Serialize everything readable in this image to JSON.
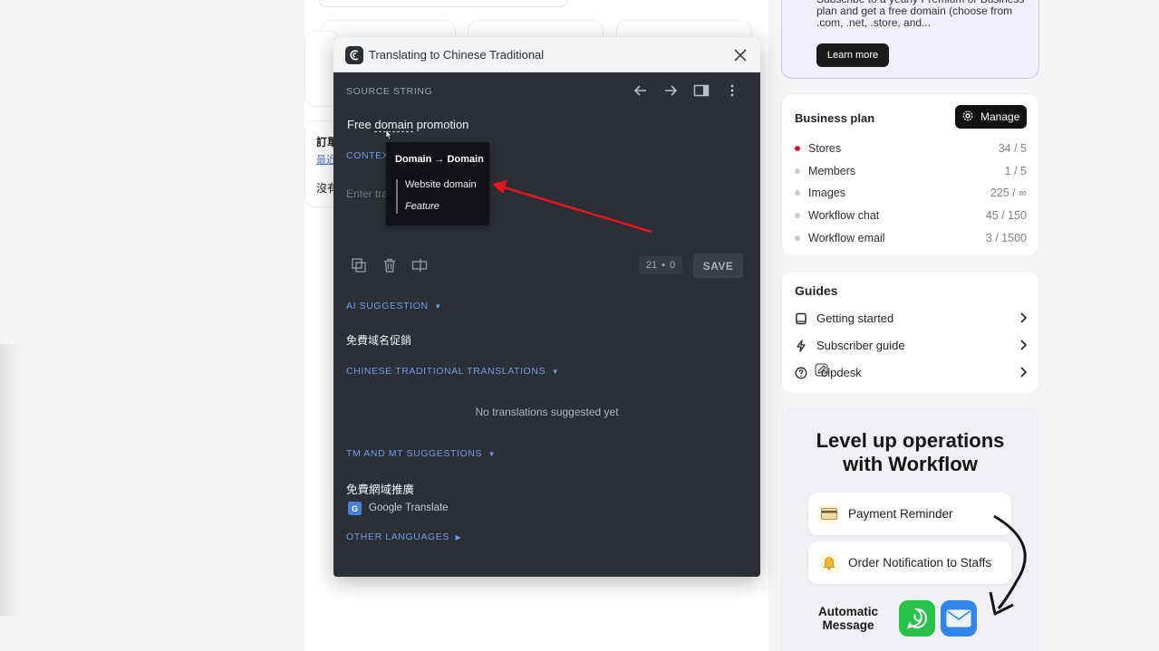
{
  "promo": {
    "text": "Subscribe to a yearly Premium or Business plan and get a free domain (choose from .com, .net, .store, and...",
    "button": "Learn more"
  },
  "business_plan": {
    "title": "Business plan",
    "manage_label": "Manage",
    "usage": [
      {
        "label": "Stores",
        "value": "34 / 5",
        "dot_color": "#e0182d"
      },
      {
        "label": "Members",
        "value": "1 / 5",
        "dot_color": "#c7ccd3"
      },
      {
        "label": "Images",
        "value": "225 / ∞",
        "dot_color": "#c7ccd3"
      },
      {
        "label": "Workflow chat",
        "value": "45 / 150",
        "dot_color": "#c7ccd3"
      },
      {
        "label": "Workflow email",
        "value": "3 / 1500",
        "dot_color": "#c7ccd3"
      }
    ]
  },
  "guides": {
    "title": "Guides",
    "items": [
      {
        "label": "Getting started",
        "icon": "book-icon"
      },
      {
        "label": "Subscriber guide",
        "icon": "lightning-icon"
      },
      {
        "label": "elpdesk",
        "icon": "question-circle-icon"
      }
    ]
  },
  "workflow": {
    "title_line1": "Level up operations",
    "title_line2": "with Workflow",
    "cards": [
      {
        "label": "Payment Reminder",
        "icon": "credit-card-icon"
      },
      {
        "label": "Order Notification to Staffs",
        "icon": "bell-icon"
      }
    ],
    "auto_line1": "Automatic",
    "auto_line2": "Message"
  },
  "background": {
    "order_label": "訂單",
    "recent_label": "最近",
    "none_label": "沒有"
  },
  "dialog": {
    "title": "Translating to Chinese Traditional",
    "source_label": "SOURCE STRING",
    "source_before": "Free ",
    "source_term": "domain",
    "source_after": " promotion",
    "context_label": "CONTEX",
    "translation_placeholder": "Enter translation here",
    "count_chars": "21",
    "count_sep": "•",
    "count_tags": "0",
    "save_label": "SAVE",
    "ai_label": "AI SUGGESTION",
    "ai_text": "免費域名促銷",
    "translations_label": "CHINESE TRADITIONAL TRANSLATIONS",
    "empty_msg": "No translations suggested yet",
    "tm_label": "TM AND MT SUGGESTIONS",
    "tm_text": "免費網域推廣",
    "tm_source": "Google Translate",
    "other_label": "OTHER LANGUAGES"
  },
  "tooltip": {
    "title": "Domain → Domain",
    "term": "Website domain",
    "type": "Feature"
  },
  "colors": {
    "accent_red": "#e0182d",
    "link_blue": "#6e9be6",
    "dialog_bg": "#2b2f36"
  }
}
